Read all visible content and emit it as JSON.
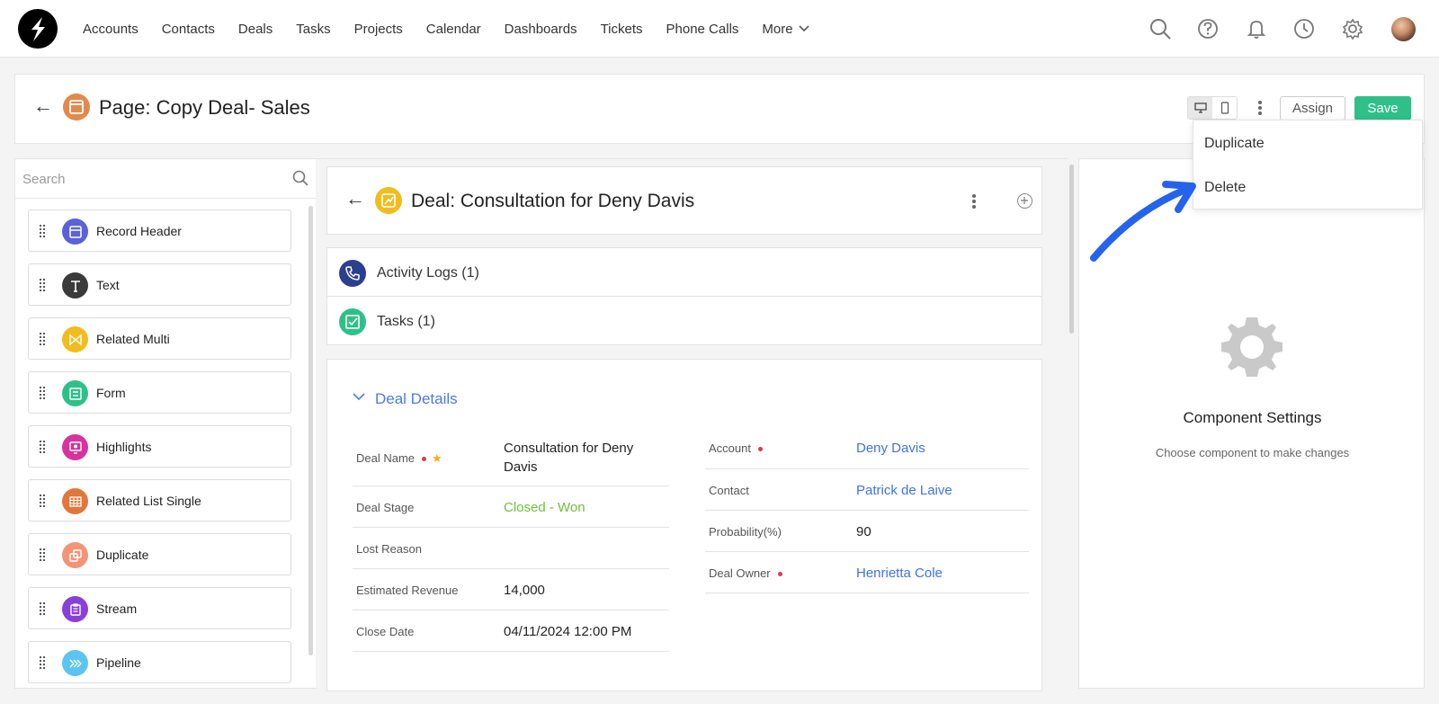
{
  "nav": {
    "links": [
      "Accounts",
      "Contacts",
      "Deals",
      "Tasks",
      "Projects",
      "Calendar",
      "Dashboards",
      "Tickets",
      "Phone Calls"
    ],
    "more_label": "More",
    "icons": [
      "search-icon",
      "help-icon",
      "bell-icon",
      "clock-icon",
      "gear-icon",
      "avatar"
    ]
  },
  "page": {
    "title": "Page: Copy Deal- Sales",
    "assign_label": "Assign",
    "save_label": "Save"
  },
  "dropdown": {
    "items": [
      "Duplicate",
      "Delete"
    ]
  },
  "left": {
    "search_placeholder": "Search",
    "components": [
      {
        "label": "Record Header",
        "color": "#5b62d6",
        "icon": "window-icon"
      },
      {
        "label": "Text",
        "color": "#3a3a3a",
        "icon": "text-icon"
      },
      {
        "label": "Related Multi",
        "color": "#f0bd1f",
        "icon": "bowtie-icon"
      },
      {
        "label": "Form",
        "color": "#2fc08a",
        "icon": "form-icon"
      },
      {
        "label": "Highlights",
        "color": "#d6339e",
        "icon": "highlight-icon"
      },
      {
        "label": "Related List Single",
        "color": "#e0773d",
        "icon": "grid-icon"
      },
      {
        "label": "Duplicate",
        "color": "#f29478",
        "icon": "duplicate-icon"
      },
      {
        "label": "Stream",
        "color": "#8a3fd6",
        "icon": "clipboard-icon"
      },
      {
        "label": "Pipeline",
        "color": "#5cc4f0",
        "icon": "chevrons-icon"
      }
    ]
  },
  "record": {
    "title": "Deal: Consultation for Deny Davis",
    "related": [
      {
        "label": "Activity Logs (1)",
        "color": "#2b3f8f",
        "icon": "phone-icon"
      },
      {
        "label": "Tasks (1)",
        "color": "#2fc08a",
        "icon": "checkbox-icon"
      }
    ],
    "section_title": "Deal Details",
    "left_fields": [
      {
        "label": "Deal Name",
        "value": "Consultation for Deny Davis",
        "required": true,
        "starred": true,
        "style": "plain"
      },
      {
        "label": "Deal Stage",
        "value": "Closed - Won",
        "required": false,
        "starred": false,
        "style": "green"
      },
      {
        "label": "Lost Reason",
        "value": "",
        "required": false,
        "starred": false,
        "style": "plain"
      },
      {
        "label": "Estimated Revenue",
        "value": "14,000",
        "required": false,
        "starred": false,
        "style": "plain"
      },
      {
        "label": "Close Date",
        "value": "04/11/2024 12:00 PM",
        "required": false,
        "starred": false,
        "style": "plain"
      }
    ],
    "right_fields": [
      {
        "label": "Account",
        "value": "Deny Davis",
        "required": true,
        "style": "link"
      },
      {
        "label": "Contact",
        "value": "Patrick de Laive",
        "required": false,
        "style": "link"
      },
      {
        "label": "Probability(%)",
        "value": "90",
        "required": false,
        "style": "plain"
      },
      {
        "label": "Deal Owner",
        "value": "Henrietta Cole",
        "required": true,
        "style": "link"
      }
    ]
  },
  "settings": {
    "title": "Component Settings",
    "subtitle": "Choose component to make changes"
  },
  "colors": {
    "accent": "#2fc08a",
    "link": "#3f73e0",
    "annotation_arrow": "#2563eb"
  }
}
